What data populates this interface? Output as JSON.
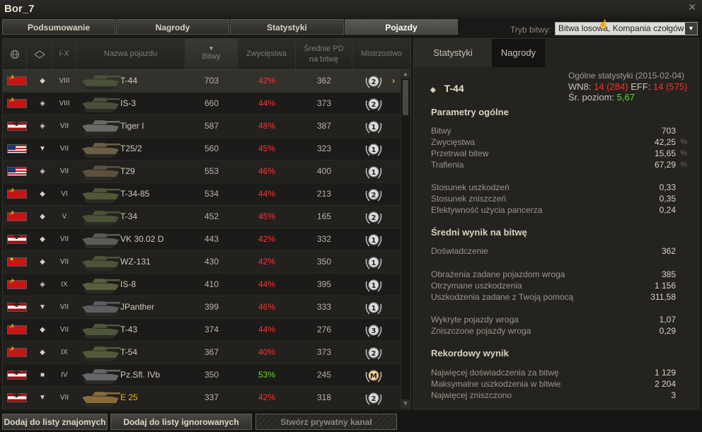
{
  "window": {
    "title": "Bor_7",
    "close": "✕"
  },
  "tabs": [
    "Podsumowanie",
    "Nagrody",
    "Statystyki",
    "Pojazdy"
  ],
  "battle_mode": {
    "label": "Tryb bitwy:",
    "value": "Bitwa losowa, Kompania czołgów",
    "arrow": "▼"
  },
  "table": {
    "headers": {
      "tier": "I-X",
      "name": "Nazwa pojazdu",
      "battles": "Bitwy",
      "wins": "Zwycięstwa",
      "avg_xp_line1": "Średnie PD",
      "avg_xp_line2": "na bitwę",
      "mastery": "Mistrzostwo"
    },
    "sort_arrow": "▼",
    "row_arrow": "›",
    "rows": [
      {
        "nation": "ussr",
        "cls": "◆",
        "tier": "VIII",
        "name": "T-44",
        "battles": "703",
        "wins": "42%",
        "win_color": "red",
        "xp": "362",
        "mastery": "2",
        "tank_color": "#4a5238",
        "selected": true,
        "gold": false
      },
      {
        "nation": "ussr",
        "cls": "◈",
        "tier": "VIII",
        "name": "IS-3",
        "battles": "660",
        "wins": "44%",
        "win_color": "red",
        "xp": "373",
        "mastery": "2",
        "tank_color": "#4a4e3a",
        "selected": false,
        "gold": false
      },
      {
        "nation": "germany",
        "cls": "◈",
        "tier": "VII",
        "name": "Tiger I",
        "battles": "587",
        "wins": "48%",
        "win_color": "red",
        "xp": "387",
        "mastery": "1",
        "tank_color": "#6a6a66",
        "selected": false,
        "gold": false
      },
      {
        "nation": "usa",
        "cls": "▼",
        "tier": "VII",
        "name": "T25/2",
        "battles": "560",
        "wins": "45%",
        "win_color": "red",
        "xp": "323",
        "mastery": "1",
        "tank_color": "#6a5e44",
        "selected": false,
        "gold": false
      },
      {
        "nation": "usa",
        "cls": "◈",
        "tier": "VII",
        "name": "T29",
        "battles": "553",
        "wins": "46%",
        "win_color": "red",
        "xp": "400",
        "mastery": "1",
        "tank_color": "#5e503c",
        "selected": false,
        "gold": false
      },
      {
        "nation": "ussr",
        "cls": "◆",
        "tier": "VI",
        "name": "T-34-85",
        "battles": "534",
        "wins": "44%",
        "win_color": "red",
        "xp": "213",
        "mastery": "2",
        "tank_color": "#505838",
        "selected": false,
        "gold": false
      },
      {
        "nation": "ussr",
        "cls": "◆",
        "tier": "V",
        "name": "T-34",
        "battles": "452",
        "wins": "45%",
        "win_color": "red",
        "xp": "165",
        "mastery": "2",
        "tank_color": "#4a5236",
        "selected": false,
        "gold": false
      },
      {
        "nation": "germany",
        "cls": "◆",
        "tier": "VII",
        "name": "VK 30.02 D",
        "battles": "443",
        "wins": "42%",
        "win_color": "red",
        "xp": "332",
        "mastery": "1",
        "tank_color": "#5a5c58",
        "selected": false,
        "gold": false
      },
      {
        "nation": "china",
        "cls": "◆",
        "tier": "VII",
        "name": "WZ-131",
        "battles": "430",
        "wins": "42%",
        "win_color": "red",
        "xp": "350",
        "mastery": "1",
        "tank_color": "#4e5438",
        "selected": false,
        "gold": false
      },
      {
        "nation": "ussr",
        "cls": "◈",
        "tier": "IX",
        "name": "IS-8",
        "battles": "410",
        "wins": "44%",
        "win_color": "red",
        "xp": "395",
        "mastery": "1",
        "tank_color": "#5a5e3e",
        "selected": false,
        "gold": false
      },
      {
        "nation": "germany",
        "cls": "▼",
        "tier": "VII",
        "name": "JPanther",
        "battles": "399",
        "wins": "46%",
        "win_color": "red",
        "xp": "333",
        "mastery": "1",
        "tank_color": "#5c5e62",
        "selected": false,
        "gold": false
      },
      {
        "nation": "ussr",
        "cls": "◆",
        "tier": "VII",
        "name": "T-43",
        "battles": "374",
        "wins": "44%",
        "win_color": "red",
        "xp": "276",
        "mastery": "3",
        "tank_color": "#4e5638",
        "selected": false,
        "gold": false
      },
      {
        "nation": "ussr",
        "cls": "◆",
        "tier": "IX",
        "name": "T-54",
        "battles": "367",
        "wins": "40%",
        "win_color": "red",
        "xp": "373",
        "mastery": "2",
        "tank_color": "#525a3a",
        "selected": false,
        "gold": false
      },
      {
        "nation": "germany",
        "cls": "■",
        "tier": "IV",
        "name": "Pz.Sfl. IVb",
        "battles": "350",
        "wins": "53%",
        "win_color": "green",
        "xp": "245",
        "mastery": "M",
        "tank_color": "#66676a",
        "selected": false,
        "gold": false
      },
      {
        "nation": "germany",
        "cls": "▼",
        "tier": "VII",
        "name": "E 25",
        "battles": "337",
        "wins": "42%",
        "win_color": "red",
        "xp": "318",
        "mastery": "2",
        "tank_color": "#8a6a3a",
        "selected": false,
        "gold": true
      }
    ]
  },
  "detail": {
    "tabs": [
      "Statystyki",
      "Nagrody"
    ],
    "vehicle_class_icon": "◆",
    "vehicle_name": "T-44",
    "overall_label": "Ogólne statystyki (2015-02-04)",
    "wn8_label": "WN8:",
    "wn8_value": "14",
    "wn8_extra": "(284)",
    "eff_label": "EFF:",
    "eff_value": "14",
    "eff_extra": "(575)",
    "avg_tier_label": "Śr. poziom:",
    "avg_tier_value": "5,67",
    "sections": [
      {
        "title": "Parametry ogólne"
      },
      {
        "title": "Średni wynik na bitwę"
      },
      {
        "title": "Rekordowy wynik"
      }
    ],
    "general": [
      {
        "label": "Bitwy",
        "value": "703",
        "unit": ""
      },
      {
        "label": "Zwycięstwa",
        "value": "42,25",
        "unit": "%"
      },
      {
        "label": "Przetrwał bitew",
        "value": "15,65",
        "unit": "%"
      },
      {
        "label": "Trafienia",
        "value": "67,29",
        "unit": "%"
      }
    ],
    "ratios": [
      {
        "label": "Stosunek uszkodzeń",
        "value": "0,33"
      },
      {
        "label": "Stosunek zniszczeń",
        "value": "0,35"
      },
      {
        "label": "Efektywność użycia pancerza",
        "value": "0,24"
      }
    ],
    "avg_xp": [
      {
        "label": "Doświadczenie",
        "value": "362"
      }
    ],
    "avg_damage": [
      {
        "label": "Obrażenia zadane pojazdom wroga",
        "value": "385"
      },
      {
        "label": "Otrzymane uszkodzenia",
        "value": "1 156"
      },
      {
        "label": "Uszkodzenia zadane z Twoją pomocą",
        "value": "311,58"
      }
    ],
    "avg_spot": [
      {
        "label": "Wykryte pojazdy wroga",
        "value": "1,07"
      },
      {
        "label": "Zniszczone pojazdy wroga",
        "value": "0,29"
      }
    ],
    "records": [
      {
        "label": "Najwięcej doświadczenia za bitwę",
        "value": "1 129"
      },
      {
        "label": "Maksymalne uszkodzenia w bitwie",
        "value": "2 204"
      },
      {
        "label": "Najwięcej zniszczono",
        "value": "3"
      }
    ]
  },
  "footer": {
    "add_friend": "Dodaj do listy znajomych",
    "add_ignore": "Dodaj do listy ignorowanych",
    "private_channel": "Stwórz prywatny kanał"
  },
  "colors": {
    "red": "#ff3030",
    "green": "#66dd22",
    "gold": "#f0b400",
    "accent_orange": "#f0a030"
  }
}
